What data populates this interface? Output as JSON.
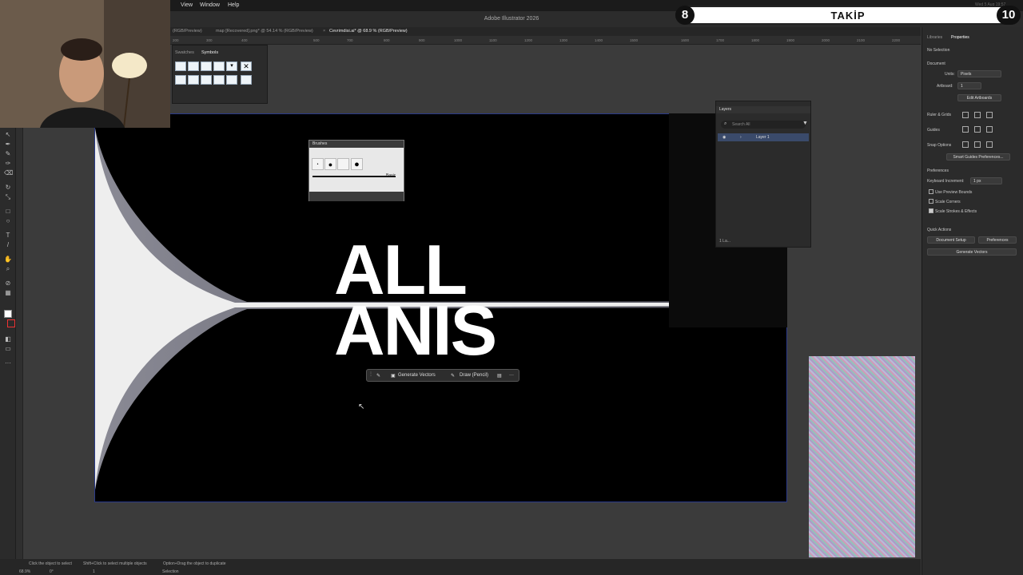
{
  "menubar": {
    "items": [
      "View",
      "Window",
      "Help"
    ]
  },
  "window": {
    "title": "Adobe Illustrator 2026"
  },
  "tabs": [
    {
      "label": "(RGB/Preview)"
    },
    {
      "label": "map [Recovered].png* @ 54.14 % (RGB/Preview)"
    },
    {
      "label": "Cevrimdisi.ai* @ 68.9 % (RGB/Preview)"
    }
  ],
  "ruler": {
    "ticks": [
      "200",
      "300",
      "400",
      "500",
      "700",
      "800",
      "900",
      "1000",
      "1100",
      "1200",
      "1300",
      "1400",
      "1500",
      "1600",
      "1700",
      "1800",
      "1900",
      "2000",
      "2100",
      "2200"
    ]
  },
  "artwork": {
    "line1": "ALL",
    "line2": "ANIS"
  },
  "context_bar": {
    "generate_label": "Generate Vectors",
    "draw_label": "Draw (Pencil)"
  },
  "symbols_panel": {
    "tab1": "Swatches",
    "tab2": "Symbols"
  },
  "brushes_panel": {
    "title": "Brushes",
    "basic_label": "Basic"
  },
  "layers_panel": {
    "title": "Layers",
    "search_placeholder": "Search All",
    "layer_name": "Layer 1",
    "footer": "1 La..."
  },
  "properties": {
    "tab_libraries": "Libraries",
    "tab_properties": "Properties",
    "no_selection": "No Selection",
    "document_header": "Document",
    "units_label": "Units:",
    "units_value": "Pixels",
    "artboard_label": "Artboard:",
    "artboard_value": "1",
    "edit_artboards": "Edit Artboards",
    "ruler_grids": "Ruler & Grids",
    "guides": "Guides",
    "snap_options": "Snap Options",
    "smart_guides": "Smart Guides Preferences...",
    "preferences_header": "Preferences",
    "keyboard_increment_label": "Keyboard Increment:",
    "keyboard_increment_value": "1 px",
    "use_preview_bounds": "Use Preview Bounds",
    "scale_corners": "Scale Corners",
    "scale_strokes": "Scale Strokes & Effects",
    "quick_actions": "Quick Actions",
    "document_setup": "Document Setup",
    "preferences_btn": "Preferences",
    "generate_vectors": "Generate Vectors"
  },
  "statusbar": {
    "hint1": "Click the object to select",
    "hint2": "Shift+Click to select multiple objects",
    "hint3": "Option+Drag the object to duplicate",
    "zoom": "68.9%",
    "angle": "0°",
    "artboard_num": "1",
    "mode": "Selection"
  },
  "overlay": {
    "left_count": "8",
    "label": "TAKİP",
    "right_count": "10"
  },
  "clock": "Wed 5 Aug 19:57"
}
